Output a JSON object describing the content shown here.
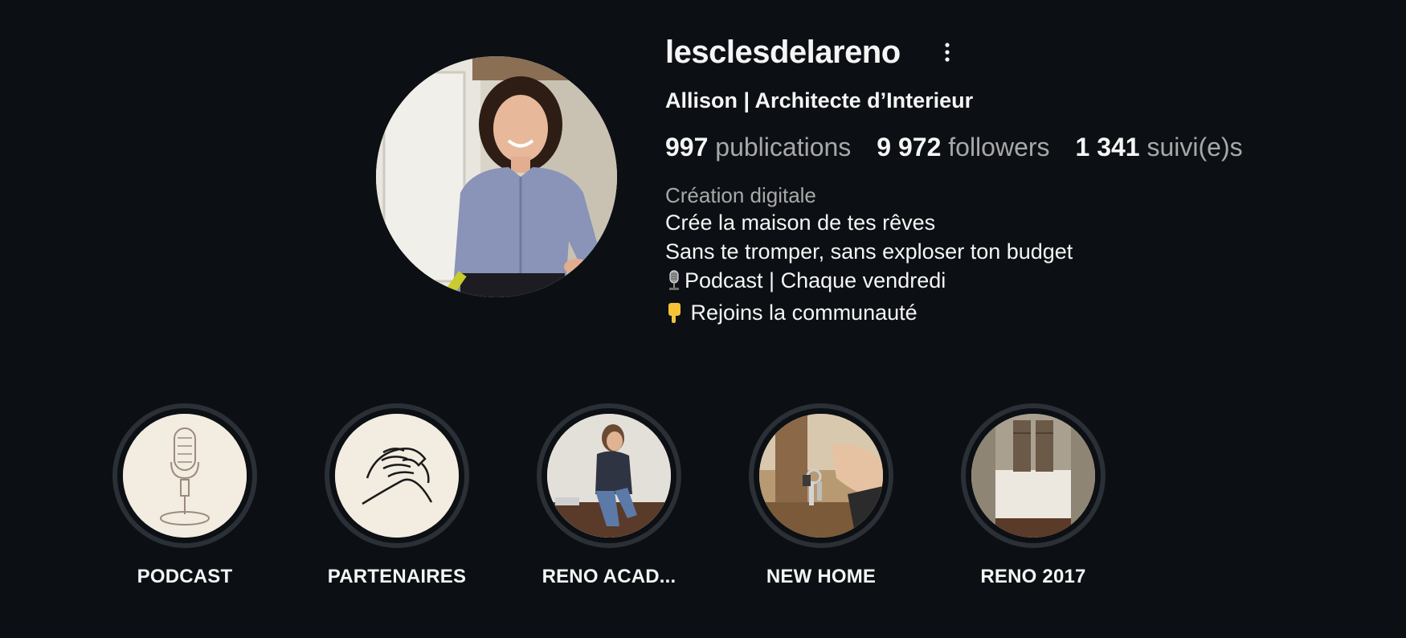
{
  "profile": {
    "username": "lesclesdelareno",
    "full_name": "Allison | Architecte d’Interieur",
    "category": "Création digitale"
  },
  "stats": {
    "posts_count": "997",
    "posts_label": "publications",
    "followers_count": "9 972",
    "followers_label": "followers",
    "following_count": "1 341",
    "following_label": "suivi(e)s"
  },
  "bio": {
    "line1": "Crée la maison de tes rêves",
    "line2": "Sans te tromper, sans exploser ton budget",
    "line3": "Podcast | Chaque vendredi",
    "line4": " Rejoins la communauté"
  },
  "icons": {
    "more": "more-vertical-icon",
    "microphone": "microphone-emoji",
    "pointing_down": "pointing-down-emoji"
  },
  "colors": {
    "background": "#0c1014",
    "text_primary": "#f5f5f5",
    "text_secondary": "#a8a8a8",
    "highlight_ring": "#2b3036"
  },
  "highlights": [
    {
      "label": "PODCAST"
    },
    {
      "label": "PARTENAIRES"
    },
    {
      "label": "RENO ACAD..."
    },
    {
      "label": "NEW HOME"
    },
    {
      "label": "RENO 2017"
    }
  ]
}
